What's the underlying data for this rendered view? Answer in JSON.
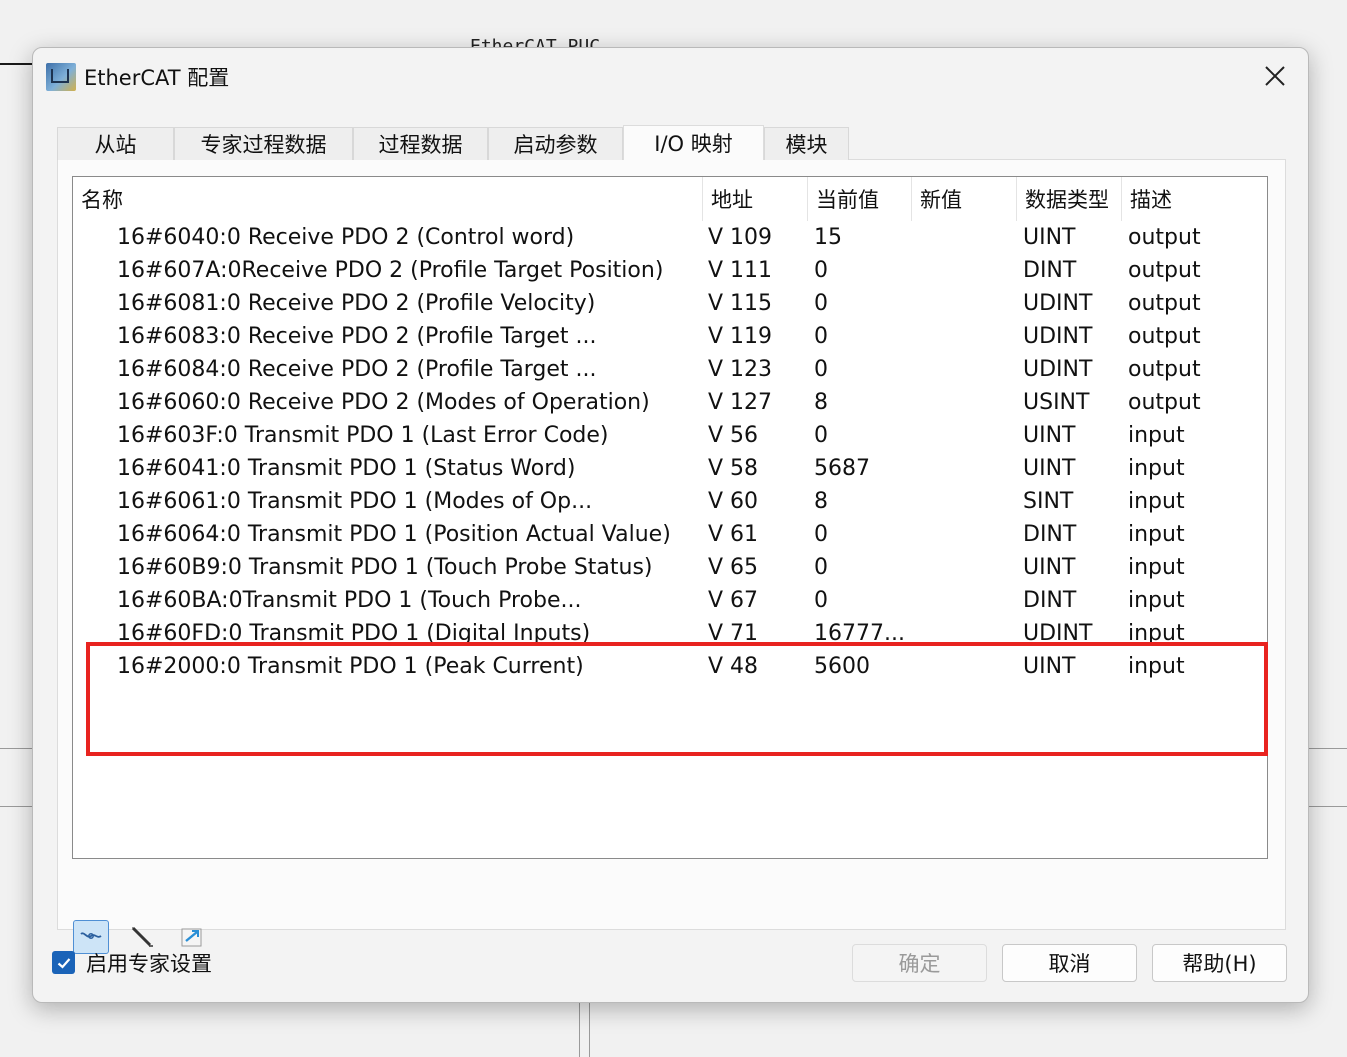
{
  "background": {
    "window_title_fragment": "EtherCAT PUC"
  },
  "dialog": {
    "title": "EtherCAT 配置",
    "close_label": "✕"
  },
  "tabs": [
    {
      "label": "从站"
    },
    {
      "label": "专家过程数据"
    },
    {
      "label": "过程数据"
    },
    {
      "label": "启动参数"
    },
    {
      "label": "I/O 映射",
      "active": true
    },
    {
      "label": "模块"
    }
  ],
  "table": {
    "headers": [
      "名称",
      "地址",
      "当前值",
      "新值",
      "数据类型",
      "描述"
    ],
    "rows": [
      {
        "name": "16#6040:0 Receive PDO 2 (Control word)",
        "address": "V 109",
        "current": "15",
        "new": "",
        "type": "UINT",
        "desc": "output"
      },
      {
        "name": "16#607A:0Receive PDO 2 (Profile Target Position)",
        "address": "V 111",
        "current": "0",
        "new": "",
        "type": "DINT",
        "desc": "output"
      },
      {
        "name": "16#6081:0 Receive PDO 2 (Profile Velocity)",
        "address": "V 115",
        "current": "0",
        "new": "",
        "type": "UDINT",
        "desc": "output"
      },
      {
        "name": "16#6083:0 Receive PDO 2 (Profile Target ...",
        "address": "V 119",
        "current": "0",
        "new": "",
        "type": "UDINT",
        "desc": "output"
      },
      {
        "name": "16#6084:0 Receive PDO 2 (Profile Target ...",
        "address": "V 123",
        "current": "0",
        "new": "",
        "type": "UDINT",
        "desc": "output"
      },
      {
        "name": "16#6060:0 Receive PDO 2 (Modes of Operation)",
        "address": "V 127",
        "current": "8",
        "new": "",
        "type": "USINT",
        "desc": "output"
      },
      {
        "name": "16#603F:0 Transmit PDO 1 (Last Error Code)",
        "address": "V 56",
        "current": "0",
        "new": "",
        "type": "UINT",
        "desc": "input"
      },
      {
        "name": "16#6041:0 Transmit PDO 1 (Status Word)",
        "address": "V 58",
        "current": "5687",
        "new": "",
        "type": "UINT",
        "desc": "input"
      },
      {
        "name": "16#6061:0 Transmit PDO 1 (Modes of Op...",
        "address": "V 60",
        "current": "8",
        "new": "",
        "type": "SINT",
        "desc": "input"
      },
      {
        "name": "16#6064:0 Transmit PDO 1 (Position Actual Value)",
        "address": "V 61",
        "current": "0",
        "new": "",
        "type": "DINT",
        "desc": "input"
      },
      {
        "name": "16#60B9:0 Transmit PDO 1 (Touch Probe Status)",
        "address": "V 65",
        "current": "0",
        "new": "",
        "type": "UINT",
        "desc": "input"
      },
      {
        "name": "16#60BA:0Transmit PDO 1 (Touch Probe...",
        "address": "V 67",
        "current": "0",
        "new": "",
        "type": "DINT",
        "desc": "input"
      },
      {
        "name": "16#60FD:0 Transmit PDO 1 (Digital Inputs)",
        "address": "V 71",
        "current": "16777...",
        "new": "",
        "type": "UDINT",
        "desc": "input"
      },
      {
        "name": "16#2000:0 Transmit PDO 1 (Peak Current)",
        "address": "V 48",
        "current": "5600",
        "new": "",
        "type": "UINT",
        "desc": "input",
        "highlighted": true
      }
    ]
  },
  "toolbar": {
    "buttons": [
      {
        "icon": "link-map-icon",
        "selected": true
      },
      {
        "icon": "pen-icon",
        "selected": false
      },
      {
        "icon": "export-icon",
        "selected": false
      }
    ]
  },
  "footer": {
    "expert_settings_label": "启用专家设置",
    "expert_settings_checked": true,
    "ok_label": "确定",
    "cancel_label": "取消",
    "help_label": "帮助(H)"
  },
  "colors": {
    "highlight": "#e8231f",
    "checkbox": "#1a63b8"
  }
}
